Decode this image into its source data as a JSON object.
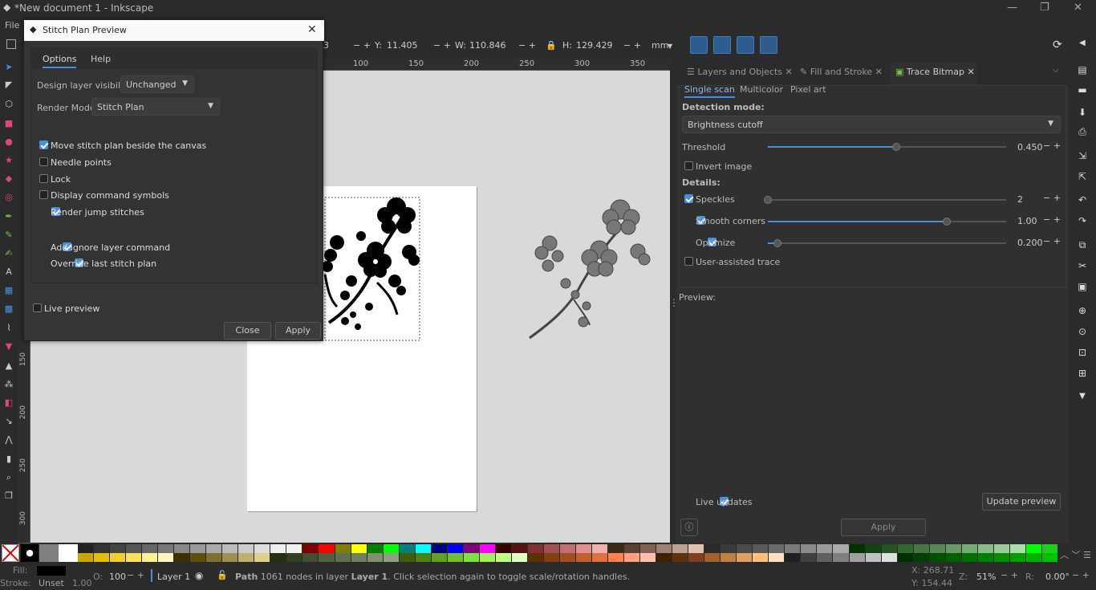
{
  "window": {
    "title": "*New document 1 - Inkscape"
  },
  "menu": {
    "file": "File"
  },
  "toolbar": {
    "x_val": "3",
    "y_label": "Y:",
    "y_val": "11.405",
    "w_label": "W:",
    "w_val": "110.846",
    "h_label": "H:",
    "h_val": "129.429",
    "unit": "mm"
  },
  "ruler": {
    "ticks": [
      "100",
      "150",
      "200",
      "250",
      "300",
      "350"
    ]
  },
  "vruler": {
    "ticks": [
      "150",
      "200",
      "250",
      "300"
    ]
  },
  "dialog": {
    "title": "Stitch Plan Preview",
    "tabs": [
      "Options",
      "Help"
    ],
    "design_label": "Design layer visibility",
    "design_value": "Unchanged",
    "render_label": "Render Mode",
    "render_value": "Stitch Plan",
    "checks": [
      {
        "label": "Move stitch plan beside the canvas",
        "checked": true
      },
      {
        "label": "Needle points",
        "checked": false
      },
      {
        "label": "Lock",
        "checked": false
      },
      {
        "label": "Display command symbols",
        "checked": false
      },
      {
        "label": "Render jump stitches",
        "checked": true
      },
      {
        "label": "Add ignore layer command",
        "checked": true
      },
      {
        "label": "Override last stitch plan",
        "checked": true
      }
    ],
    "live_preview": "Live preview",
    "close": "Close",
    "apply": "Apply"
  },
  "dock": {
    "tabs": [
      "Layers and Objects",
      "Fill and Stroke",
      "Trace Bitmap"
    ],
    "subtabs": [
      "Single scan",
      "Multicolor",
      "Pixel art"
    ],
    "detection_label": "Detection mode:",
    "detection_value": "Brightness cutoff",
    "threshold_label": "Threshold",
    "threshold_value": "0.450",
    "threshold_frac": 0.54,
    "invert": "Invert image",
    "details": "Details:",
    "speckles_label": "Speckles",
    "speckles_value": "2",
    "speckles_frac": 0.0,
    "smooth_label": "Smooth corners",
    "smooth_value": "1.00",
    "smooth_frac": 0.75,
    "optimize_label": "Optimize",
    "optimize_value": "0.200",
    "optimize_frac": 0.04,
    "user_assisted": "User-assisted trace",
    "preview": "Preview:",
    "live_updates": "Live updates",
    "update_preview": "Update preview",
    "apply": "Apply"
  },
  "status": {
    "fill_label": "Fill:",
    "stroke_label": "Stroke:",
    "stroke_value": "Unset",
    "stroke_width": "1.00",
    "opacity_label": "O:",
    "opacity": "100",
    "layer": "Layer 1",
    "msg_path": "Path",
    "msg_rest": "1061 nodes in layer",
    "msg_layer": "Layer 1",
    "msg_tail": ". Click selection again to toggle scale/rotation handles.",
    "x": "X:  268.71",
    "y": "Y:  154.44",
    "zoom_label": "Z:",
    "zoom": "51%",
    "rot_label": "R:",
    "rot": "0.00°"
  },
  "colors": {
    "accent": "#4a90d9",
    "canvas": "#d9d9d9",
    "panel": "#303030"
  }
}
